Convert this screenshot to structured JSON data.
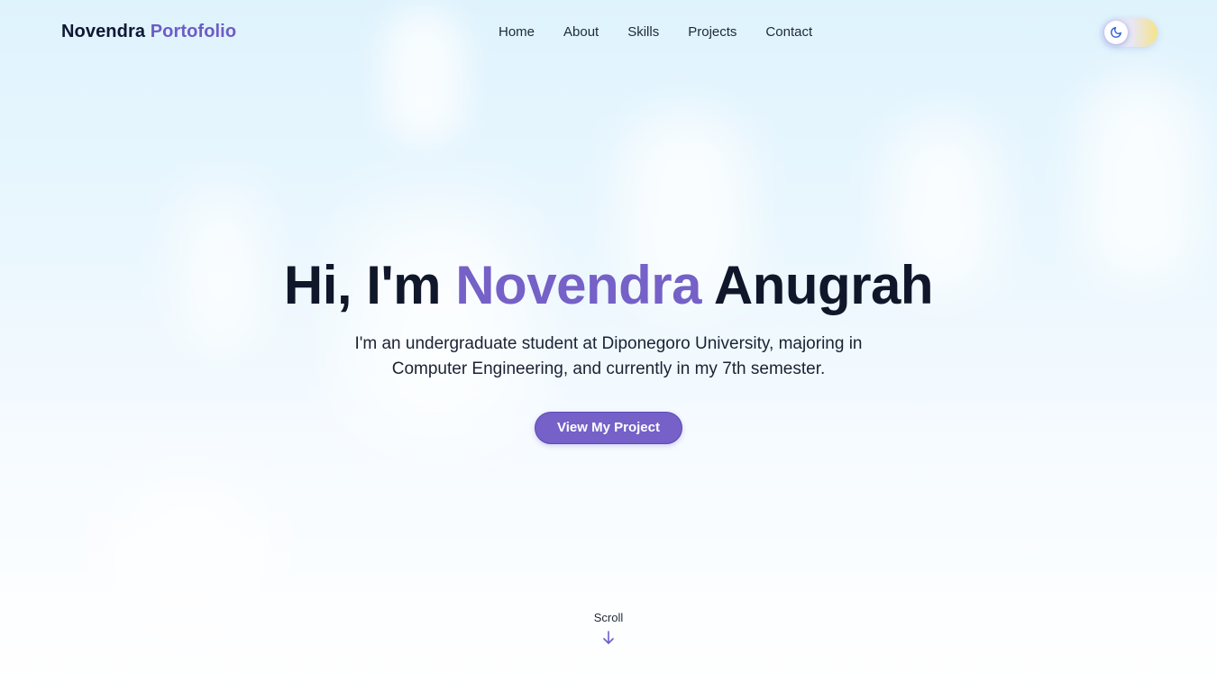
{
  "header": {
    "logo_name": "Novendra",
    "logo_accent": "Portofolio",
    "nav": [
      {
        "label": "Home"
      },
      {
        "label": "About"
      },
      {
        "label": "Skills"
      },
      {
        "label": "Projects"
      },
      {
        "label": "Contact"
      }
    ],
    "theme_toggle": {
      "icon": "moon-icon",
      "state": "light"
    }
  },
  "hero": {
    "greeting": "Hi, I'm",
    "first_name": "Novendra",
    "last_name": "Anugrah",
    "description": "I'm an undergraduate student at Diponegoro University, majoring in Computer Engineering, and currently in my 7th semester.",
    "cta_label": "View My Project"
  },
  "scroll": {
    "label": "Scroll",
    "icon": "arrow-down-icon"
  },
  "colors": {
    "accent": "#7561c7",
    "text_dark": "#10172a",
    "toggle_sun": "#f5e48a"
  }
}
